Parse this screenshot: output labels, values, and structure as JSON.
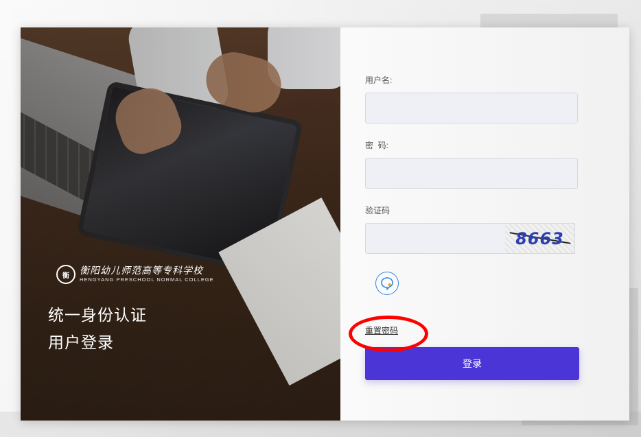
{
  "branding": {
    "school_name_cn": "衡阳幼儿师范高等专科学校",
    "school_name_en": "HENGYANG PRESCHOOL NORMAL COLLEGE",
    "seal_text": "衡"
  },
  "hero": {
    "title_line1": "统一身份认证",
    "title_line2": "用户登录"
  },
  "form": {
    "username": {
      "label": "用户名:",
      "value": "",
      "placeholder": ""
    },
    "password": {
      "label": "密  码:",
      "value": "",
      "placeholder": ""
    },
    "captcha": {
      "label": "验证码",
      "value": "",
      "placeholder": "",
      "image_text": "8663"
    },
    "chat_icon": "chat-bubble-icon",
    "reset_password_link": "重置密码",
    "login_button": "登录"
  },
  "colors": {
    "primary_button": "#4b35d6",
    "annotation": "#ff0000",
    "input_bg": "#eef0f5"
  }
}
